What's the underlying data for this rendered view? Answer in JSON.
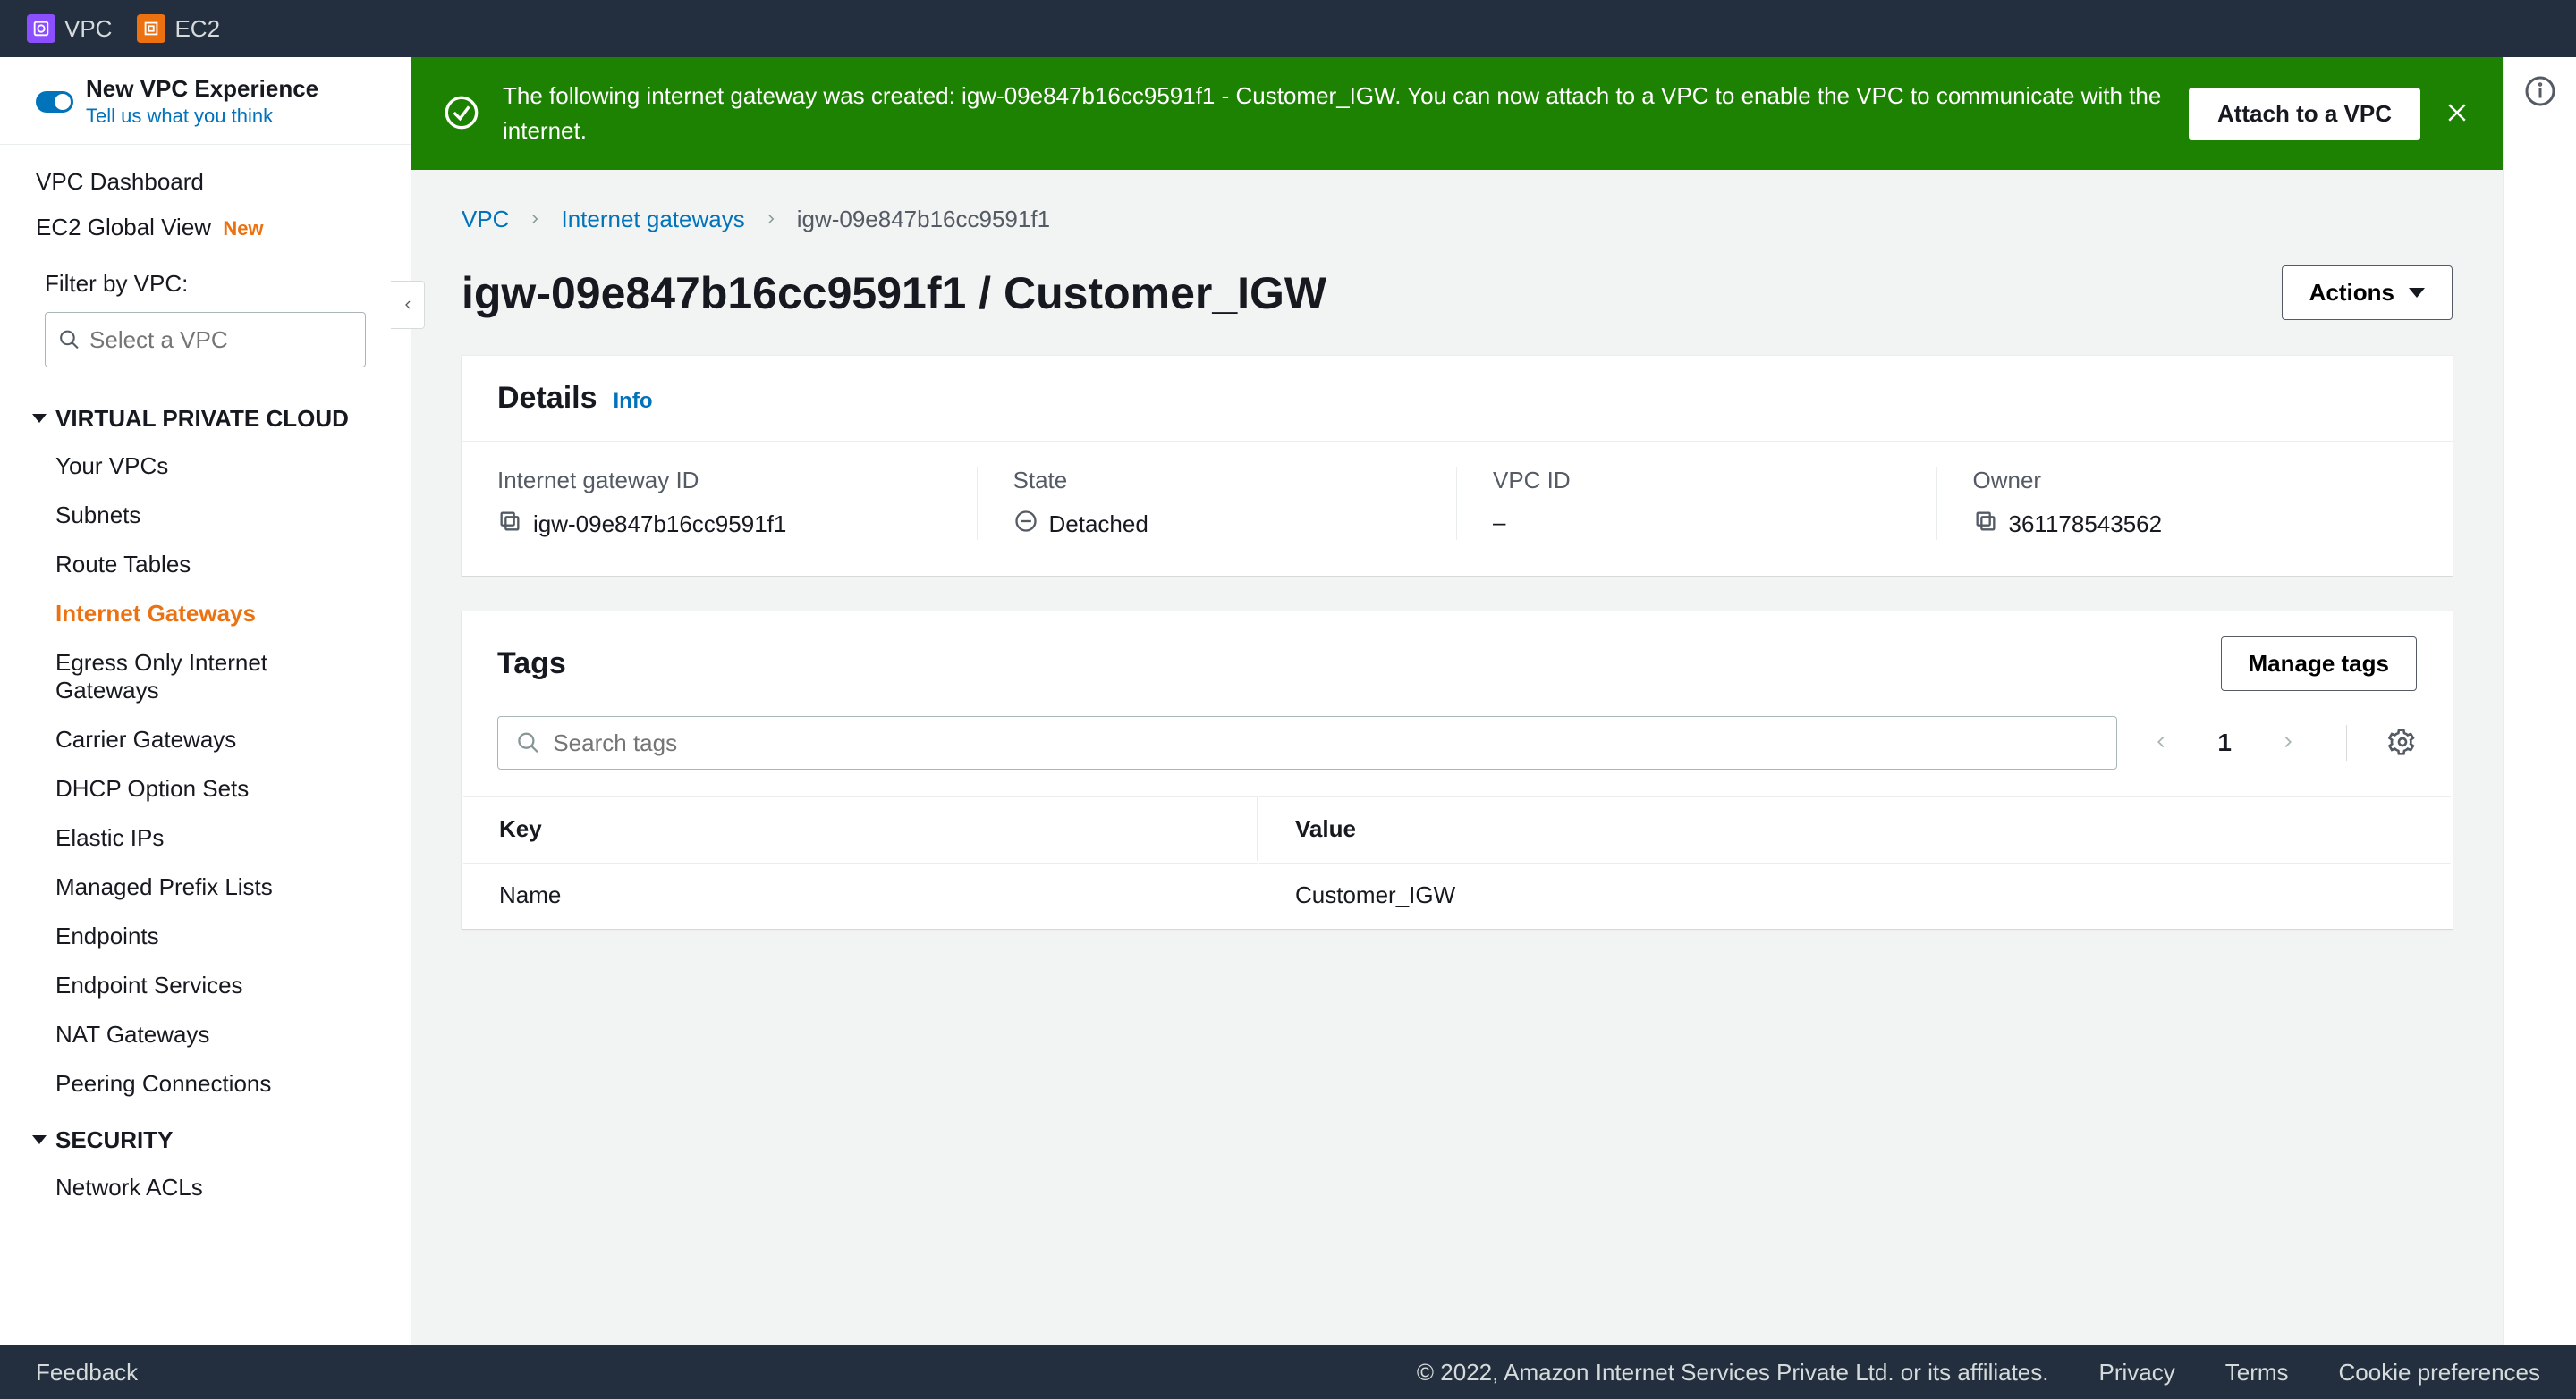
{
  "topnav": {
    "items": [
      "VPC",
      "EC2"
    ]
  },
  "sidebar": {
    "experience_title": "New VPC Experience",
    "experience_sub": "Tell us what you think",
    "dashboard": "VPC Dashboard",
    "global_view": "EC2 Global View",
    "new_badge": "New",
    "filter_label": "Filter by VPC:",
    "filter_placeholder": "Select a VPC",
    "section_vpc": "VIRTUAL PRIVATE CLOUD",
    "vpc_items": [
      "Your VPCs",
      "Subnets",
      "Route Tables",
      "Internet Gateways",
      "Egress Only Internet Gateways",
      "Carrier Gateways",
      "DHCP Option Sets",
      "Elastic IPs",
      "Managed Prefix Lists",
      "Endpoints",
      "Endpoint Services",
      "NAT Gateways",
      "Peering Connections"
    ],
    "section_security": "SECURITY",
    "security_items": [
      "Network ACLs"
    ]
  },
  "banner": {
    "text": "The following internet gateway was created: igw-09e847b16cc9591f1 - Customer_IGW. You can now attach to a VPC to enable the VPC to communicate with the internet.",
    "button": "Attach to a VPC"
  },
  "breadcrumb": {
    "vpc": "VPC",
    "igw": "Internet gateways",
    "current": "igw-09e847b16cc9591f1"
  },
  "page_title": "igw-09e847b16cc9591f1 / Customer_IGW",
  "actions_label": "Actions",
  "details": {
    "title": "Details",
    "info": "Info",
    "igw_id_label": "Internet gateway ID",
    "igw_id_value": "igw-09e847b16cc9591f1",
    "state_label": "State",
    "state_value": "Detached",
    "vpc_id_label": "VPC ID",
    "vpc_id_value": "–",
    "owner_label": "Owner",
    "owner_value": "361178543562"
  },
  "tags": {
    "title": "Tags",
    "manage": "Manage tags",
    "search_placeholder": "Search tags",
    "page": "1",
    "key_header": "Key",
    "value_header": "Value",
    "rows": [
      {
        "key": "Name",
        "value": "Customer_IGW"
      }
    ]
  },
  "footer": {
    "feedback": "Feedback",
    "copyright": "© 2022, Amazon Internet Services Private Ltd. or its affiliates.",
    "privacy": "Privacy",
    "terms": "Terms",
    "cookies": "Cookie preferences"
  }
}
